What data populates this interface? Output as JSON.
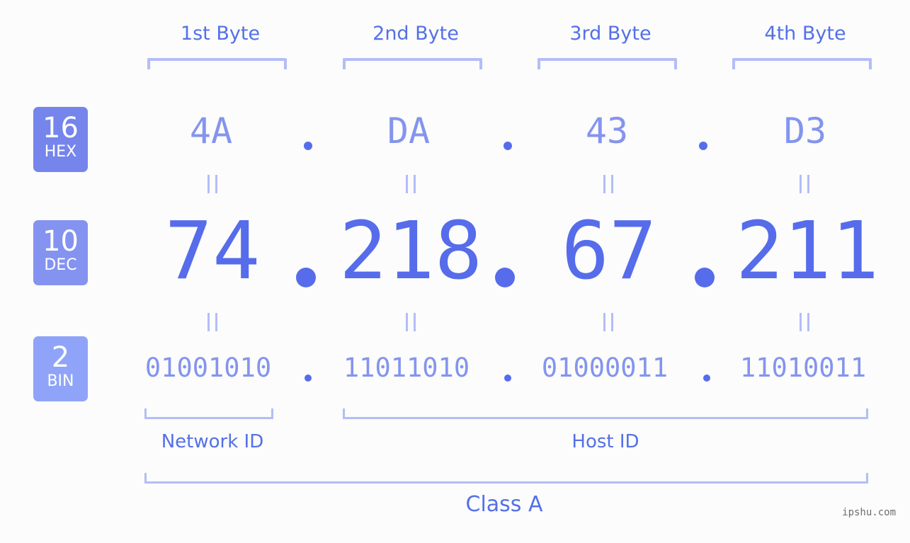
{
  "bytes": [
    {
      "header": "1st Byte",
      "hex": "4A",
      "dec": "74",
      "bin": "01001010"
    },
    {
      "header": "2nd Byte",
      "hex": "DA",
      "dec": "218",
      "bin": "11011010"
    },
    {
      "header": "3rd Byte",
      "hex": "43",
      "dec": "67",
      "bin": "01000011"
    },
    {
      "header": "4th Byte",
      "hex": "D3",
      "dec": "211",
      "bin": "11010011"
    }
  ],
  "separator": ".",
  "equals_icon": "double-vertical-bar",
  "badges": [
    {
      "base": "16",
      "label": "HEX",
      "color": "#7585ec"
    },
    {
      "base": "10",
      "label": "DEC",
      "color": "#8493f0"
    },
    {
      "base": "2",
      "label": "BIN",
      "color": "#8fa4f8"
    }
  ],
  "network_id_label": "Network ID",
  "host_id_label": "Host ID",
  "class_label": "Class A",
  "watermark": "ipshu.com",
  "colors": {
    "accent": "#566ceb",
    "light": "#8494ee",
    "bracket": "#b4bdf8",
    "background": "#fbfcfb"
  }
}
